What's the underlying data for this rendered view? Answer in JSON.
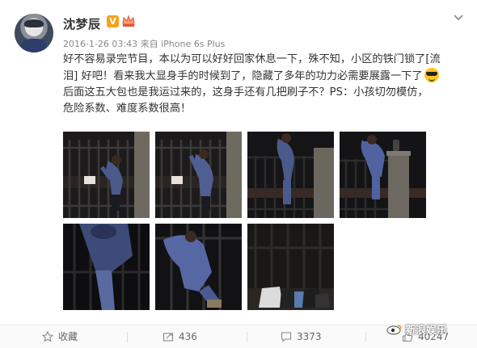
{
  "post": {
    "author": "沈梦辰",
    "verified_badge": "V",
    "meta": "2016-1-26 03:43 来自 iPhone 6s Plus",
    "text_line1": "好不容易录完节目，本以为可以好好回家休息一下，殊不知，小区的铁门锁了[流",
    "text_line2": "泪] 好吧！看来我大显身手的时候到了，隐藏了多年的功力必需要展露一下了",
    "text_line3": "   后面这五大包也是我运过来的，这身手还有几把刷子不？PS：小孩切勿模仿，",
    "text_line4": "危险系数、难度系数很高！"
  },
  "photos": [
    {
      "icon": "photo-woman-climbing-gate-1"
    },
    {
      "icon": "photo-woman-climbing-gate-2"
    },
    {
      "icon": "photo-woman-on-gate-top-1"
    },
    {
      "icon": "photo-woman-on-gate-top-2"
    },
    {
      "icon": "photo-woman-climbing-closeup-1"
    },
    {
      "icon": "photo-woman-climbing-closeup-2"
    },
    {
      "icon": "photo-bags-behind-gate"
    }
  ],
  "actions": {
    "favorite_label": "收藏",
    "repost_count": "436",
    "comment_count": "3373",
    "like_count": "40247"
  },
  "watermark": "新浪娱乐",
  "colors": {
    "vip": "#f7a21b",
    "meta": "#888888",
    "text": "#333333"
  }
}
